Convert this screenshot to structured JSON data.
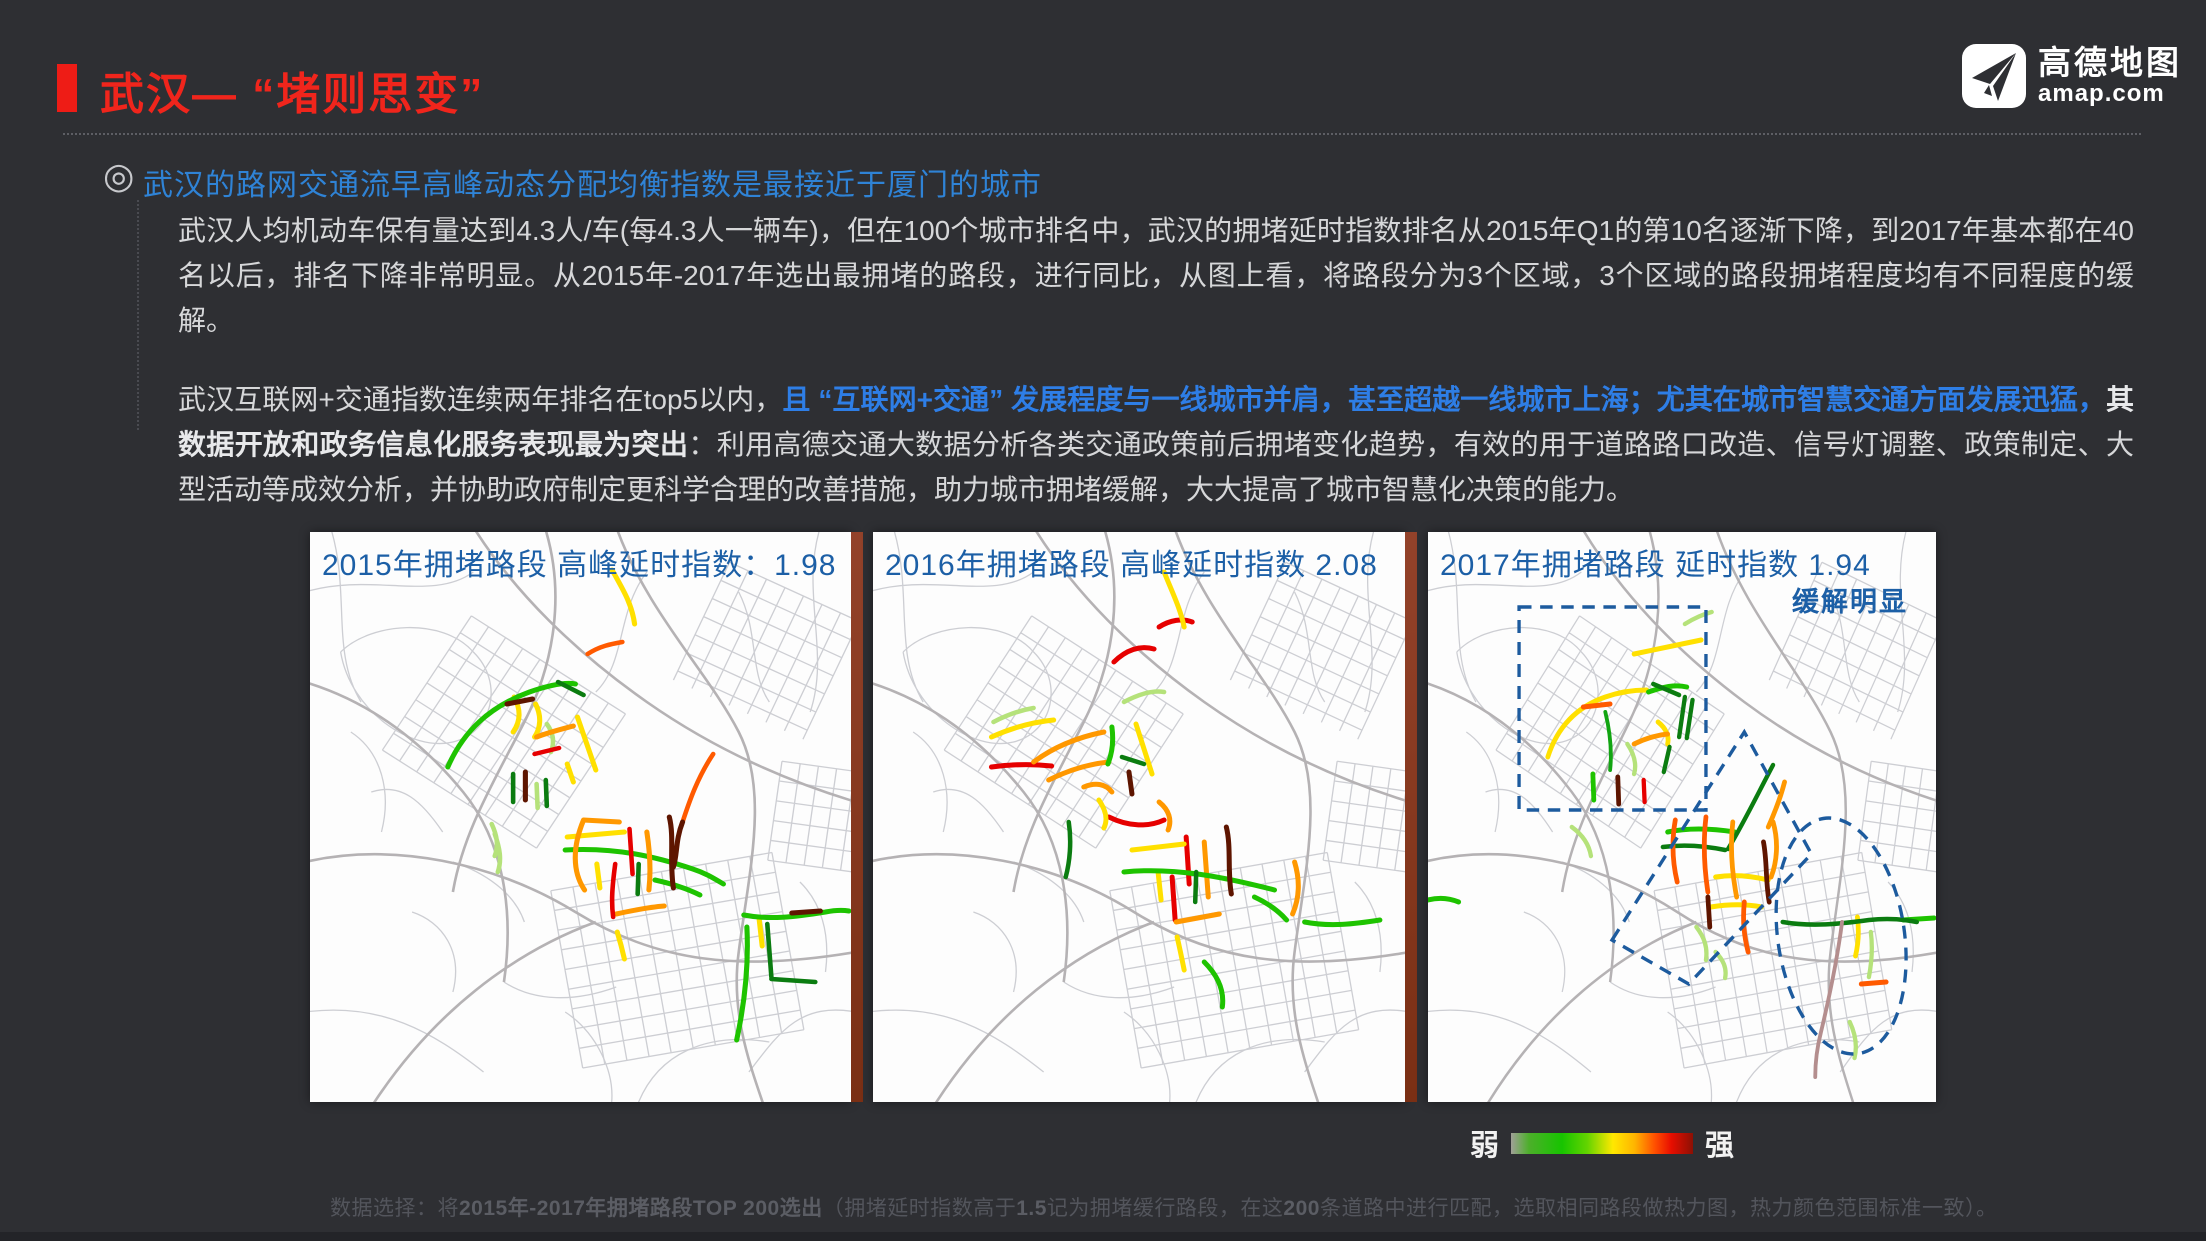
{
  "slide": {
    "title": "武汉— “堵则思变”",
    "logo": {
      "brand": "高德地图",
      "domain": "amap.com"
    },
    "subtitle": "武汉的路网交通流早高峰动态分配均衡指数是最接近于厦门的城市",
    "body": {
      "p1": "武汉人均机动车保有量达到4.3人/车(每4.3人一辆车)，但在100个城市排名中，武汉的拥堵延时指数排名从2015年Q1的第10名逐渐下降，到2017年基本都在40名以后，排名下降非常明显。从2015年-2017年选出最拥堵的路段，进行同比，从图上看，将路段分为3个区域，3个区域的路段拥堵程度均有不同程度的缓解。",
      "p2a": "武汉互联网+交通指数连续两年排名在top5以内，",
      "p2b": "且 “互联网+交通” 发展程度与一线城市并肩，甚至超越一线城市上海；尤其在城市智慧交通方面发展迅猛，",
      "p2c": "其数据开放和政务信息化服务表现最为突出",
      "p2d": "：利用高德交通大数据分析各类交通政策前后拥堵变化趋势，有效的用于道路路口改造、信号灯调整、政策制定、大型活动等成效分析，并协助政府制定更科学合理的改善措施，助力城市拥堵缓解，大大提高了城市智慧化决策的能力。"
    },
    "maps": [
      {
        "title": "2015年拥堵路段 高峰延时指数：1.98"
      },
      {
        "title": "2016年拥堵路段  高峰延时指数 2.08"
      },
      {
        "title": "2017年拥堵路段  延时指数  1.94",
        "annotation": "缓解明显"
      }
    ],
    "legend": {
      "weak_label": "弱",
      "strong_label": "强",
      "scale_colors": [
        "#a0a097",
        "#17c400",
        "#ffe800",
        "#ffb400",
        "#ff5000",
        "#8c1004"
      ]
    },
    "footnote": {
      "s1": "数据选择：将",
      "s2": "2015年-2017年拥堵路段TOP 200选出",
      "s3": "（拥堵延时指数高于",
      "s4": "1.5",
      "s5": "记为拥堵缓行路段，在这",
      "s6": "200",
      "s7": "条道路中进行匹配，选取相同路段做热力图，热力颜色范围标准一致）。"
    }
  }
}
